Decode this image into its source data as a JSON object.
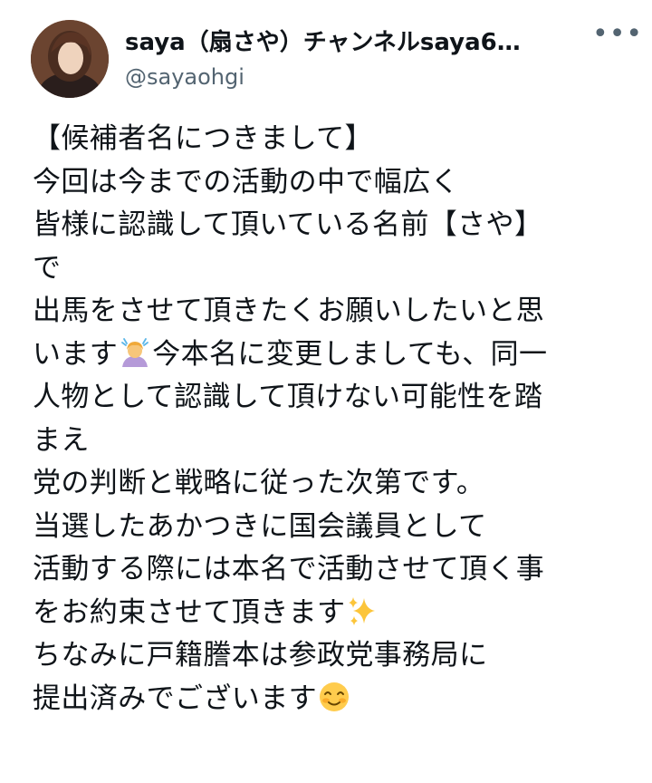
{
  "author": {
    "display_name": "saya（扇さや）チャンネルsaya6…",
    "handle": "@sayaohgi"
  },
  "more_icon": "more-icon",
  "emojis": [
    "person-gesturing-ok-icon",
    "sparkles-icon",
    "smiling-face-icon"
  ],
  "tweet": {
    "lines": [
      "【候補者名につきまして】",
      "今回は今までの活動の中で幅広く",
      "皆様に認識して頂いている名前【さや】",
      "で",
      "出馬をさせて頂きたくお願いしたいと思",
      "います",
      "今本名に変更しましても、同一",
      "人物として認識して頂けない可能性を踏",
      "まえ",
      "党の判断と戦略に従った次第です。",
      "当選したあかつきに国会議員として",
      "活動する際には本名で活動させて頂く事",
      "をお約束させて頂きます",
      "ちなみに戸籍謄本は参政党事務局に",
      "提出済みでございます"
    ]
  }
}
